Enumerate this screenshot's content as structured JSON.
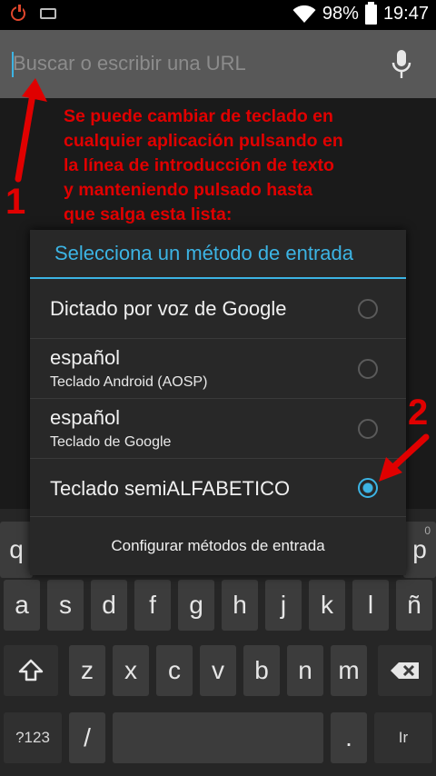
{
  "status_bar": {
    "battery": "98%",
    "time": "19:47"
  },
  "browser": {
    "url_placeholder": "Buscar o escribir una URL"
  },
  "annotation": {
    "lines": [
      "Se puede cambiar de teclado en",
      "cualquier aplicación pulsando en",
      "la línea de introducción de texto",
      "y manteniendo pulsado hasta",
      "que salga esta lista:"
    ],
    "step1": "1",
    "step2": "2",
    "color": "#e00000"
  },
  "dialog": {
    "title": "Selecciona un método de entrada",
    "options": [
      {
        "label": "Dictado por voz de Google",
        "sublabel": "",
        "selected": false
      },
      {
        "label": "español",
        "sublabel": "Teclado Android (AOSP)",
        "selected": false
      },
      {
        "label": "español",
        "sublabel": "Teclado de Google",
        "selected": false
      },
      {
        "label": "Teclado semiALFABETICO",
        "sublabel": "",
        "selected": true
      }
    ],
    "footer": "Configurar métodos de entrada",
    "accent": "#3cb4e4"
  },
  "keyboard": {
    "row1_left": "q",
    "row1_right": "p",
    "row1_hint": "0",
    "row2": [
      "a",
      "s",
      "d",
      "f",
      "g",
      "h",
      "j",
      "k",
      "l",
      "ñ"
    ],
    "row3": [
      "z",
      "x",
      "c",
      "v",
      "b",
      "n",
      "m"
    ],
    "numbers_key": "?123",
    "slash_key": "/",
    "period_key": ".",
    "go_key": "Ir",
    "shift_icon": "shift-icon",
    "delete_icon": "backspace-icon"
  }
}
